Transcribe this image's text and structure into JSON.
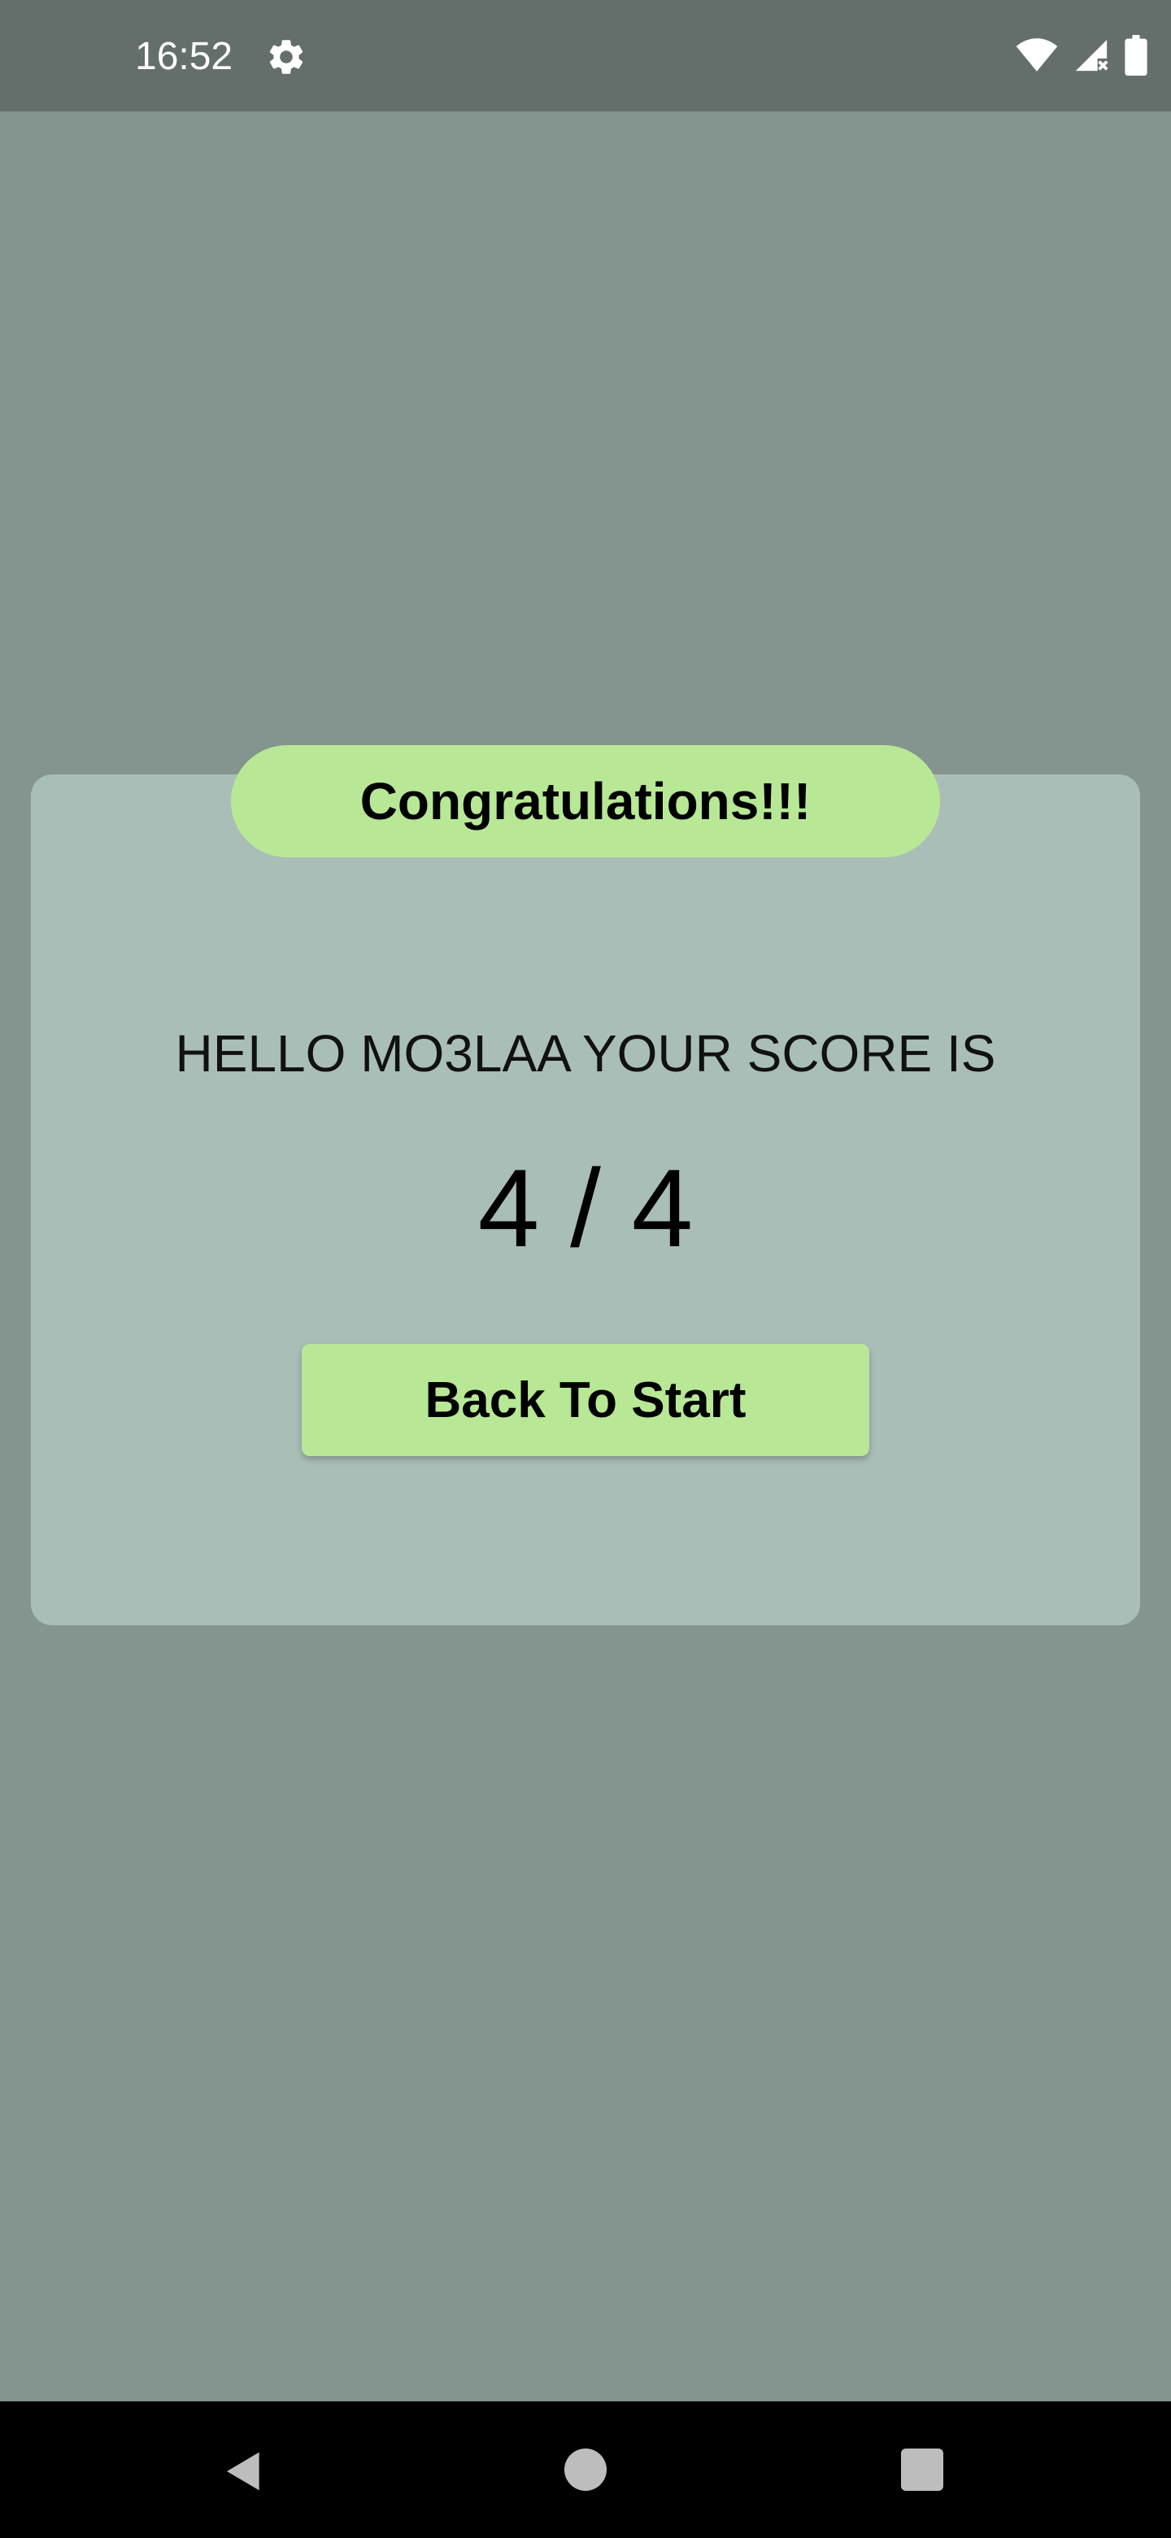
{
  "status_bar": {
    "time": "16:52",
    "icons": [
      "settings-icon",
      "wifi-icon",
      "signal-icon",
      "battery-icon"
    ],
    "background": "#646e6a"
  },
  "result_card": {
    "heading": "Congratulations!!!",
    "message": "HELLO MO3LAA YOUR SCORE IS",
    "score": "4 / 4",
    "back_button_label": "Back To Start"
  },
  "colors": {
    "page_background": "#84948e",
    "card_background": "#aabeb8",
    "accent_green": "#b8e896"
  },
  "nav_bar": {
    "icons": [
      "back-icon",
      "home-icon",
      "recents-icon"
    ]
  }
}
